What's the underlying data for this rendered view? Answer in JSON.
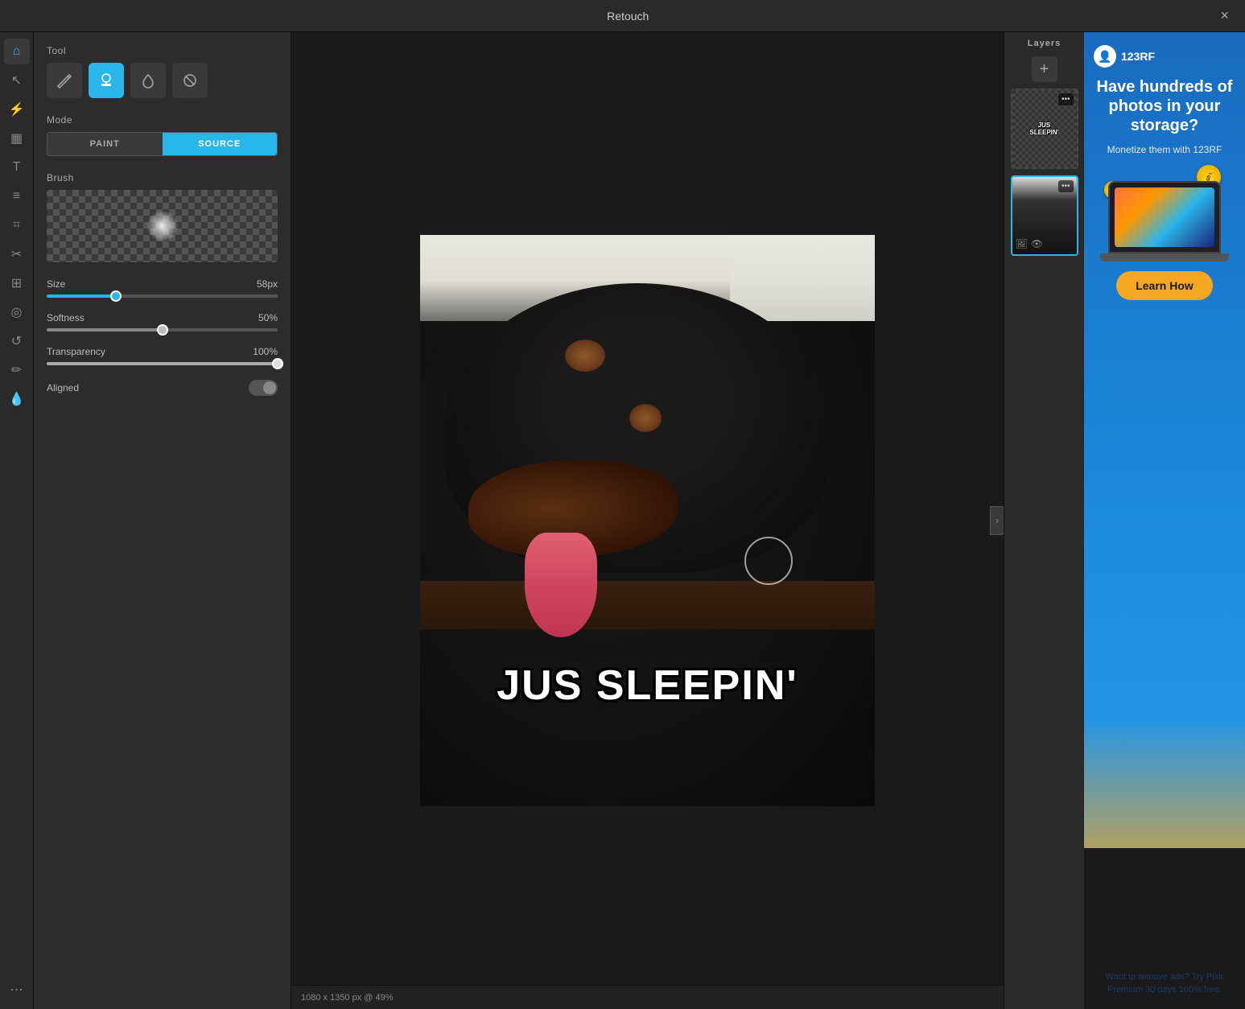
{
  "app": {
    "title": "Retouch",
    "close_label": "×"
  },
  "panel": {
    "tool_section": "Tool",
    "mode_section": "Mode",
    "brush_section": "Brush",
    "size_label": "Size",
    "size_value": "58px",
    "softness_label": "Softness",
    "softness_value": "50%",
    "transparency_label": "Transparency",
    "transparency_value": "100%",
    "aligned_label": "Aligned",
    "paint_mode": "PAINT",
    "source_mode": "SOURCE",
    "size_percent": 30,
    "softness_percent": 50,
    "transparency_percent": 100
  },
  "canvas": {
    "status": "1080 x 1350 px @ 49%",
    "image_text": "JUS SLEEPIN'"
  },
  "layers": {
    "title": "Layers",
    "add_label": "+",
    "layer1_label": "JUS SLEEPIN'",
    "layer2_label": "dog photo"
  },
  "ad": {
    "logo_icon": "👤",
    "logo_text": "123RF",
    "headline": "Have hundreds of photos in your storage?",
    "subtext": "Monetize them with 123RF",
    "learn_btn": "Learn How",
    "remove_text": "Want to remove ads? Try Pixlr Premium 30 days 100% free."
  },
  "left_tools": [
    {
      "name": "home-icon",
      "symbol": "⌂"
    },
    {
      "name": "cursor-icon",
      "symbol": "↖"
    },
    {
      "name": "flash-icon",
      "symbol": "⚡"
    },
    {
      "name": "grid-icon",
      "symbol": "▦"
    },
    {
      "name": "text-icon",
      "symbol": "T"
    },
    {
      "name": "lines-icon",
      "symbol": "≡"
    },
    {
      "name": "crop-icon",
      "symbol": "⌗"
    },
    {
      "name": "scissors-icon",
      "symbol": "✂"
    },
    {
      "name": "adjust-icon",
      "symbol": "≔"
    },
    {
      "name": "circle-icon",
      "symbol": "◎"
    },
    {
      "name": "spiral-icon",
      "symbol": "↺"
    },
    {
      "name": "brush-icon",
      "symbol": "✏"
    },
    {
      "name": "drop-icon",
      "symbol": "💧"
    },
    {
      "name": "more-icon",
      "symbol": "⋯"
    }
  ]
}
